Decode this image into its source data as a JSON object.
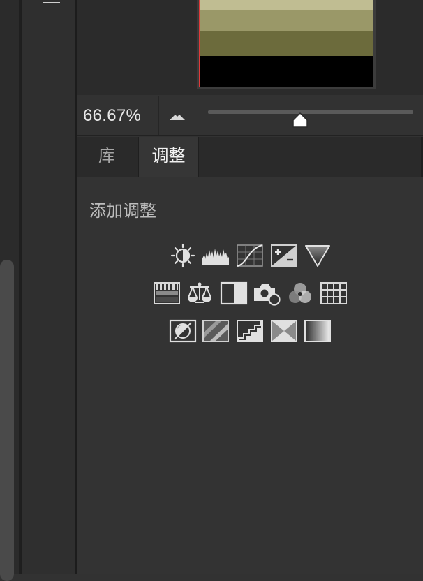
{
  "navigator": {
    "preview_bands": [
      "#c0bd92",
      "#9a9868",
      "#6c6b3c",
      "#000000"
    ],
    "accent_border": "#e03a3a"
  },
  "zoom": {
    "value": "66.67%",
    "zoom_out_icon": "mountain-small-icon",
    "slider_level_fraction": 0.45
  },
  "tabs": [
    {
      "label": "库",
      "active": false
    },
    {
      "label": "调整",
      "active": true
    }
  ],
  "panel": {
    "title": "添加调整",
    "rows": [
      [
        "brightness-contrast-icon",
        "levels-icon",
        "curves-icon",
        "exposure-icon",
        "vibrance-icon"
      ],
      [
        "hue-saturation-icon",
        "color-balance-icon",
        "black-white-icon",
        "photo-filter-icon",
        "channel-mixer-icon",
        "color-lookup-icon"
      ],
      [
        "invert-icon",
        "posterize-icon",
        "threshold-icon",
        "selective-color-icon",
        "gradient-map-icon"
      ]
    ]
  }
}
